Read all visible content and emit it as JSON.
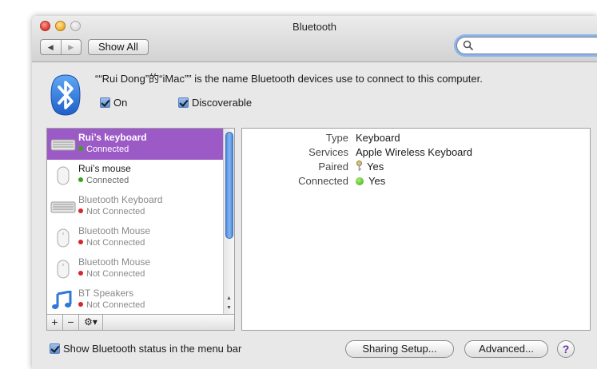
{
  "window": {
    "title": "Bluetooth"
  },
  "toolbar": {
    "back_icon": "chevron-left-icon",
    "forward_icon": "chevron-right-icon",
    "show_all_label": "Show All",
    "search_value": "",
    "search_placeholder": ""
  },
  "header": {
    "description": "““Rui Dong”的“iMac”” is the name Bluetooth devices use to connect to this computer.",
    "on_label": "On",
    "on_checked": true,
    "discoverable_label": "Discoverable",
    "discoverable_checked": true
  },
  "devices": [
    {
      "name": "Rui’s keyboard",
      "status": "Connected",
      "icon": "keyboard-icon",
      "selected": true,
      "connected": true
    },
    {
      "name": "Rui’s mouse",
      "status": "Connected",
      "icon": "mouse-icon",
      "selected": false,
      "connected": true
    },
    {
      "name": "Bluetooth Keyboard",
      "status": "Not Connected",
      "icon": "keyboard-icon",
      "selected": false,
      "connected": false
    },
    {
      "name": "Bluetooth Mouse",
      "status": "Not Connected",
      "icon": "mouse-icon",
      "selected": false,
      "connected": false
    },
    {
      "name": "Bluetooth Mouse",
      "status": "Not Connected",
      "icon": "mouse-icon",
      "selected": false,
      "connected": false
    },
    {
      "name": "BT Speakers",
      "status": "Not Connected",
      "icon": "music-note-icon",
      "selected": false,
      "connected": false
    }
  ],
  "list_controls": {
    "add": "+",
    "remove": "−",
    "gear": "⚙▾"
  },
  "details": {
    "type_label": "Type",
    "type_value": "Keyboard",
    "services_label": "Services",
    "services_value": "Apple Wireless Keyboard",
    "paired_label": "Paired",
    "paired_value": "Yes",
    "connected_label": "Connected",
    "connected_value": "Yes"
  },
  "footer": {
    "menubar_label": "Show Bluetooth status in the menu bar",
    "menubar_checked": true,
    "sharing_label": "Sharing Setup...",
    "advanced_label": "Advanced...",
    "help_label": "?"
  },
  "colors": {
    "selection": "#9c5ac7",
    "connected_dot": "#3aa519",
    "not_connected_dot": "#d8262b",
    "scroll_thumb": "#4b89d9"
  }
}
